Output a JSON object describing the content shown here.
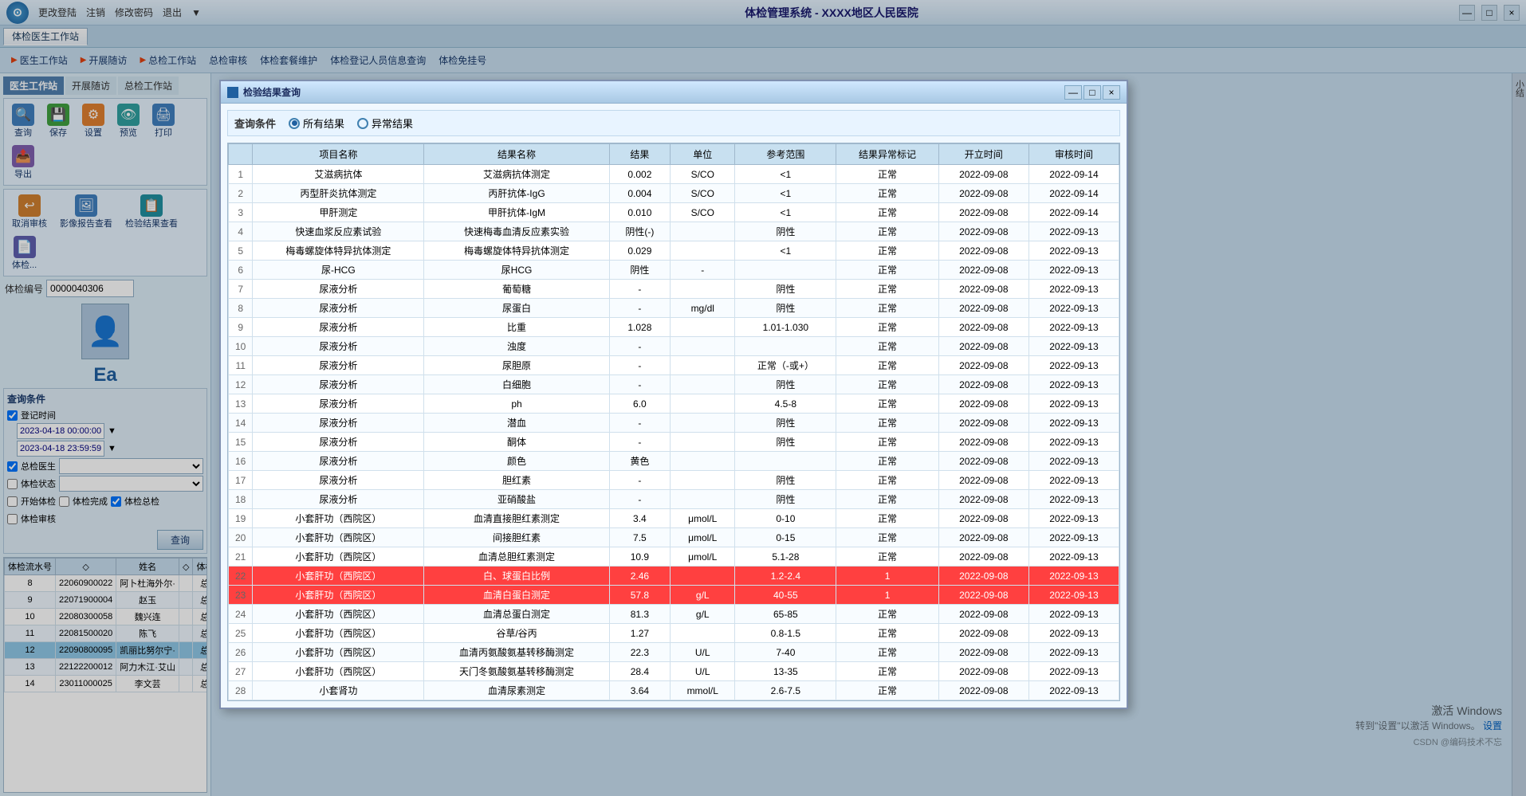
{
  "app": {
    "title": "体检管理系统 - XXXX地区人民医院",
    "logo_letter": "⊙",
    "tab_label": "体检医生工作站"
  },
  "menubar": {
    "items": [
      "更改登陆",
      "注销",
      "修改密码",
      "退出"
    ]
  },
  "nav": {
    "items": [
      {
        "label": "医生工作站",
        "icon": "▶"
      },
      {
        "label": "开展随访",
        "icon": "▶"
      },
      {
        "label": "总检工作站",
        "icon": "▶"
      },
      {
        "label": "总检审核",
        "icon": ""
      },
      {
        "label": "体检套餐维护",
        "icon": ""
      },
      {
        "label": "体检登记人员信息查询",
        "icon": ""
      },
      {
        "label": "体检免挂号",
        "icon": ""
      }
    ]
  },
  "left_tabs": {
    "items": [
      "医生工作站",
      "开展随访",
      "总检工作站"
    ]
  },
  "toolbar1": {
    "buttons": [
      {
        "label": "查询",
        "icon": "🔍",
        "color": "blue"
      },
      {
        "label": "保存",
        "icon": "💾",
        "color": "green"
      },
      {
        "label": "设置",
        "icon": "⚙",
        "color": "orange"
      },
      {
        "label": "预览",
        "icon": "👁",
        "color": "teal"
      },
      {
        "label": "打印",
        "icon": "🖨",
        "color": "blue"
      },
      {
        "label": "导出",
        "icon": "📤",
        "color": "purple"
      }
    ]
  },
  "toolbar2": {
    "buttons": [
      {
        "label": "取消审核",
        "icon": "↩"
      },
      {
        "label": "影像报告查看",
        "icon": "🖼"
      },
      {
        "label": "检验结果查看",
        "icon": "📋"
      },
      {
        "label": "体检...",
        "icon": "📄"
      }
    ]
  },
  "exam_id": {
    "label": "体检编号",
    "value": "0000040306"
  },
  "query_condition": {
    "label": "查询条件",
    "login_time_label": "登记时间",
    "date_from": "2023-04-18 00:00:00",
    "date_to": "2023-04-18 23:59:59",
    "chief_doctor_label": "总检医生",
    "exam_status_label": "体检状态",
    "checkboxes": [
      {
        "label": "开始体检",
        "checked": false
      },
      {
        "label": "体检完成",
        "checked": false
      },
      {
        "label": "体检总检",
        "checked": true
      },
      {
        "label": "体检审核",
        "checked": false
      }
    ],
    "query_btn": "查询"
  },
  "list_table": {
    "headers": [
      "体检流水号",
      "◇",
      "姓名",
      "◇",
      "体检..."
    ],
    "rows": [
      {
        "num": "8",
        "id": "22060900022",
        "name": "阿卜杜海外尔·",
        "status": "总检"
      },
      {
        "num": "9",
        "id": "22071900004",
        "name": "赵玉",
        "status": "总检"
      },
      {
        "num": "10",
        "id": "22080300058",
        "name": "魏兴连",
        "status": "总检"
      },
      {
        "num": "11",
        "id": "22081500020",
        "name": "陈飞",
        "status": "总检"
      },
      {
        "num": "12",
        "id": "22090800095",
        "name": "凯丽比努尔宁·",
        "status": "总检"
      },
      {
        "num": "13",
        "id": "22122200012",
        "name": "阿力木江·艾山",
        "status": "总检"
      },
      {
        "num": "14",
        "id": "23011000025",
        "name": "李文芸",
        "status": "总检"
      }
    ]
  },
  "dialog": {
    "title": "检验结果查询",
    "query_condition_label": "查询条件",
    "radio_options": [
      {
        "label": "所有结果",
        "checked": true
      },
      {
        "label": "异常结果",
        "checked": false
      }
    ],
    "table": {
      "headers": [
        "项目名称",
        "结果名称",
        "结果",
        "单位",
        "参考范围",
        "结果异常标记",
        "开立时间",
        "审核时间"
      ],
      "rows": [
        {
          "num": "1",
          "item": "艾滋病抗体",
          "result_name": "艾滋病抗体测定",
          "result": "0.002",
          "unit": "S/CO",
          "ref": "<1",
          "flag": "正常",
          "open_time": "2022-09-08",
          "review_time": "2022-09-14",
          "abnormal": false
        },
        {
          "num": "2",
          "item": "丙型肝炎抗体测定",
          "result_name": "丙肝抗体-IgG",
          "result": "0.004",
          "unit": "S/CO",
          "ref": "<1",
          "flag": "正常",
          "open_time": "2022-09-08",
          "review_time": "2022-09-14",
          "abnormal": false
        },
        {
          "num": "3",
          "item": "甲肝测定",
          "result_name": "甲肝抗体-IgM",
          "result": "0.010",
          "unit": "S/CO",
          "ref": "<1",
          "flag": "正常",
          "open_time": "2022-09-08",
          "review_time": "2022-09-14",
          "abnormal": false
        },
        {
          "num": "4",
          "item": "快速血浆反应素试验",
          "result_name": "快速梅毒血清反应素实验",
          "result": "阴性(-)",
          "unit": "",
          "ref": "阴性",
          "flag": "正常",
          "open_time": "2022-09-08",
          "review_time": "2022-09-13",
          "abnormal": false
        },
        {
          "num": "5",
          "item": "梅毒螺旋体特异抗体测定",
          "result_name": "梅毒螺旋体特异抗体测定",
          "result": "0.029",
          "unit": "",
          "ref": "<1",
          "flag": "正常",
          "open_time": "2022-09-08",
          "review_time": "2022-09-13",
          "abnormal": false
        },
        {
          "num": "6",
          "item": "尿-HCG",
          "result_name": "尿HCG",
          "result": "阴性",
          "unit": "-",
          "ref": "",
          "flag": "正常",
          "open_time": "2022-09-08",
          "review_time": "2022-09-13",
          "abnormal": false
        },
        {
          "num": "7",
          "item": "尿液分析",
          "result_name": "葡萄糖",
          "result": "-",
          "unit": "",
          "ref": "阴性",
          "flag": "正常",
          "open_time": "2022-09-08",
          "review_time": "2022-09-13",
          "abnormal": false
        },
        {
          "num": "8",
          "item": "尿液分析",
          "result_name": "尿蛋白",
          "result": "-",
          "unit": "mg/dl",
          "ref": "阴性",
          "flag": "正常",
          "open_time": "2022-09-08",
          "review_time": "2022-09-13",
          "abnormal": false
        },
        {
          "num": "9",
          "item": "尿液分析",
          "result_name": "比重",
          "result": "1.028",
          "unit": "",
          "ref": "1.01-1.030",
          "flag": "正常",
          "open_time": "2022-09-08",
          "review_time": "2022-09-13",
          "abnormal": false
        },
        {
          "num": "10",
          "item": "尿液分析",
          "result_name": "浊度",
          "result": "-",
          "unit": "",
          "ref": "",
          "flag": "正常",
          "open_time": "2022-09-08",
          "review_time": "2022-09-13",
          "abnormal": false
        },
        {
          "num": "11",
          "item": "尿液分析",
          "result_name": "尿胆原",
          "result": "-",
          "unit": "",
          "ref": "正常（-或+）",
          "flag": "正常",
          "open_time": "2022-09-08",
          "review_time": "2022-09-13",
          "abnormal": false
        },
        {
          "num": "12",
          "item": "尿液分析",
          "result_name": "白细胞",
          "result": "-",
          "unit": "",
          "ref": "阴性",
          "flag": "正常",
          "open_time": "2022-09-08",
          "review_time": "2022-09-13",
          "abnormal": false
        },
        {
          "num": "13",
          "item": "尿液分析",
          "result_name": "ph",
          "result": "6.0",
          "unit": "",
          "ref": "4.5-8",
          "flag": "正常",
          "open_time": "2022-09-08",
          "review_time": "2022-09-13",
          "abnormal": false
        },
        {
          "num": "14",
          "item": "尿液分析",
          "result_name": "潜血",
          "result": "-",
          "unit": "",
          "ref": "阴性",
          "flag": "正常",
          "open_time": "2022-09-08",
          "review_time": "2022-09-13",
          "abnormal": false
        },
        {
          "num": "15",
          "item": "尿液分析",
          "result_name": "酮体",
          "result": "-",
          "unit": "",
          "ref": "阴性",
          "flag": "正常",
          "open_time": "2022-09-08",
          "review_time": "2022-09-13",
          "abnormal": false
        },
        {
          "num": "16",
          "item": "尿液分析",
          "result_name": "颜色",
          "result": "黄色",
          "unit": "",
          "ref": "",
          "flag": "正常",
          "open_time": "2022-09-08",
          "review_time": "2022-09-13",
          "abnormal": false
        },
        {
          "num": "17",
          "item": "尿液分析",
          "result_name": "胆红素",
          "result": "-",
          "unit": "",
          "ref": "阴性",
          "flag": "正常",
          "open_time": "2022-09-08",
          "review_time": "2022-09-13",
          "abnormal": false
        },
        {
          "num": "18",
          "item": "尿液分析",
          "result_name": "亚硝酸盐",
          "result": "-",
          "unit": "",
          "ref": "阴性",
          "flag": "正常",
          "open_time": "2022-09-08",
          "review_time": "2022-09-13",
          "abnormal": false
        },
        {
          "num": "19",
          "item": "小套肝功（西院区）",
          "result_name": "血清直接胆红素测定",
          "result": "3.4",
          "unit": "μmol/L",
          "ref": "0-10",
          "flag": "正常",
          "open_time": "2022-09-08",
          "review_time": "2022-09-13",
          "abnormal": false
        },
        {
          "num": "20",
          "item": "小套肝功（西院区）",
          "result_name": "间接胆红素",
          "result": "7.5",
          "unit": "μmol/L",
          "ref": "0-15",
          "flag": "正常",
          "open_time": "2022-09-08",
          "review_time": "2022-09-13",
          "abnormal": false
        },
        {
          "num": "21",
          "item": "小套肝功（西院区）",
          "result_name": "血清总胆红素测定",
          "result": "10.9",
          "unit": "μmol/L",
          "ref": "5.1-28",
          "flag": "正常",
          "open_time": "2022-09-08",
          "review_time": "2022-09-13",
          "abnormal": false
        },
        {
          "num": "22",
          "item": "小套肝功（西院区）",
          "result_name": "白、球蛋白比例",
          "result": "2.46",
          "unit": "",
          "ref": "1.2-2.4",
          "flag": "1",
          "open_time": "2022-09-08",
          "review_time": "2022-09-13",
          "abnormal": true
        },
        {
          "num": "23",
          "item": "小套肝功（西院区）",
          "result_name": "血清白蛋白测定",
          "result": "57.8",
          "unit": "g/L",
          "ref": "40-55",
          "flag": "1",
          "open_time": "2022-09-08",
          "review_time": "2022-09-13",
          "abnormal": true
        },
        {
          "num": "24",
          "item": "小套肝功（西院区）",
          "result_name": "血清总蛋白测定",
          "result": "81.3",
          "unit": "g/L",
          "ref": "65-85",
          "flag": "正常",
          "open_time": "2022-09-08",
          "review_time": "2022-09-13",
          "abnormal": false
        },
        {
          "num": "25",
          "item": "小套肝功（西院区）",
          "result_name": "谷草/谷丙",
          "result": "1.27",
          "unit": "",
          "ref": "0.8-1.5",
          "flag": "正常",
          "open_time": "2022-09-08",
          "review_time": "2022-09-13",
          "abnormal": false
        },
        {
          "num": "26",
          "item": "小套肝功（西院区）",
          "result_name": "血清丙氨酸氨基转移酶测定",
          "result": "22.3",
          "unit": "U/L",
          "ref": "7-40",
          "flag": "正常",
          "open_time": "2022-09-08",
          "review_time": "2022-09-13",
          "abnormal": false
        },
        {
          "num": "27",
          "item": "小套肝功（西院区）",
          "result_name": "天门冬氨酸氨基转移酶测定",
          "result": "28.4",
          "unit": "U/L",
          "ref": "13-35",
          "flag": "正常",
          "open_time": "2022-09-08",
          "review_time": "2022-09-13",
          "abnormal": false
        },
        {
          "num": "28",
          "item": "小套肾功",
          "result_name": "血清尿素测定",
          "result": "3.64",
          "unit": "mmol/L",
          "ref": "2.6-7.5",
          "flag": "正常",
          "open_time": "2022-09-08",
          "review_time": "2022-09-13",
          "abnormal": false
        }
      ]
    },
    "close_btn": "×",
    "minimize_btn": "—",
    "maximize_btn": "□"
  },
  "right_strip": {
    "items": [
      "小结"
    ]
  },
  "watermark": {
    "line1": "激活 Windows",
    "line2": "转到\"设置\"以激活 Windows。",
    "line3": "设置",
    "csdn": "CSDN @编码技术不忘"
  },
  "ea_label": "Ea"
}
